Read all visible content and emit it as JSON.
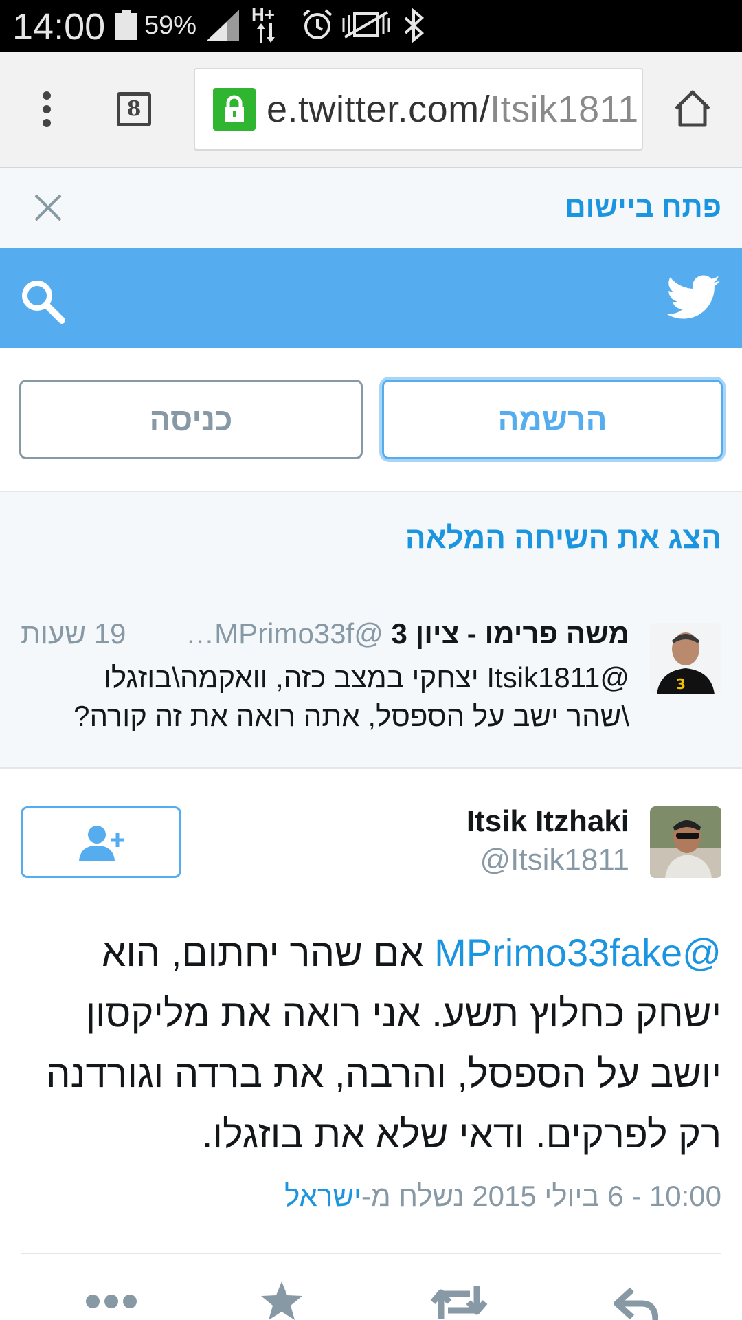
{
  "status_bar": {
    "time": "14:00",
    "battery_pct": "59%",
    "network_label": "H+"
  },
  "browser": {
    "url_host": "e.twitter.com/",
    "url_path": "Itsik1811",
    "tab_count": "8"
  },
  "open_app_banner": {
    "label": "פתח ביישום"
  },
  "auth": {
    "signup_label": "הרשמה",
    "login_label": "כניסה"
  },
  "conversation": {
    "show_full_label": "הצג את השיחה המלאה",
    "reply": {
      "author_name": "משה פרימו - ציון 3",
      "author_handle": "@MPrimo33f…",
      "time": "19 שעות",
      "text_line1": "@Itsik1811 יצחקי במצב כזה, וואקמה\\בוזגלו",
      "text_line2": "\\שהר ישב על הספסל, אתה רואה את זה קורה?"
    }
  },
  "tweet": {
    "author_name": "Itsik Itzhaki",
    "author_handle": "@Itsik1811",
    "mention": "@MPrimo33fake",
    "text": " אם שהר יחתום, הוא ישחק כחלוץ תשע. אני רואה את מליקסון יושב על הספסל, והרבה, את ברדה וגורדנה רק לפרקים. ודאי שלא את בוזגלו.",
    "timestamp": "10:00 - 6 ביולי 2015 נשלח מ-",
    "place": "ישראל"
  },
  "colors": {
    "twitter_blue": "#55acee",
    "link_blue": "#1b95e0",
    "muted": "#8899a6"
  }
}
